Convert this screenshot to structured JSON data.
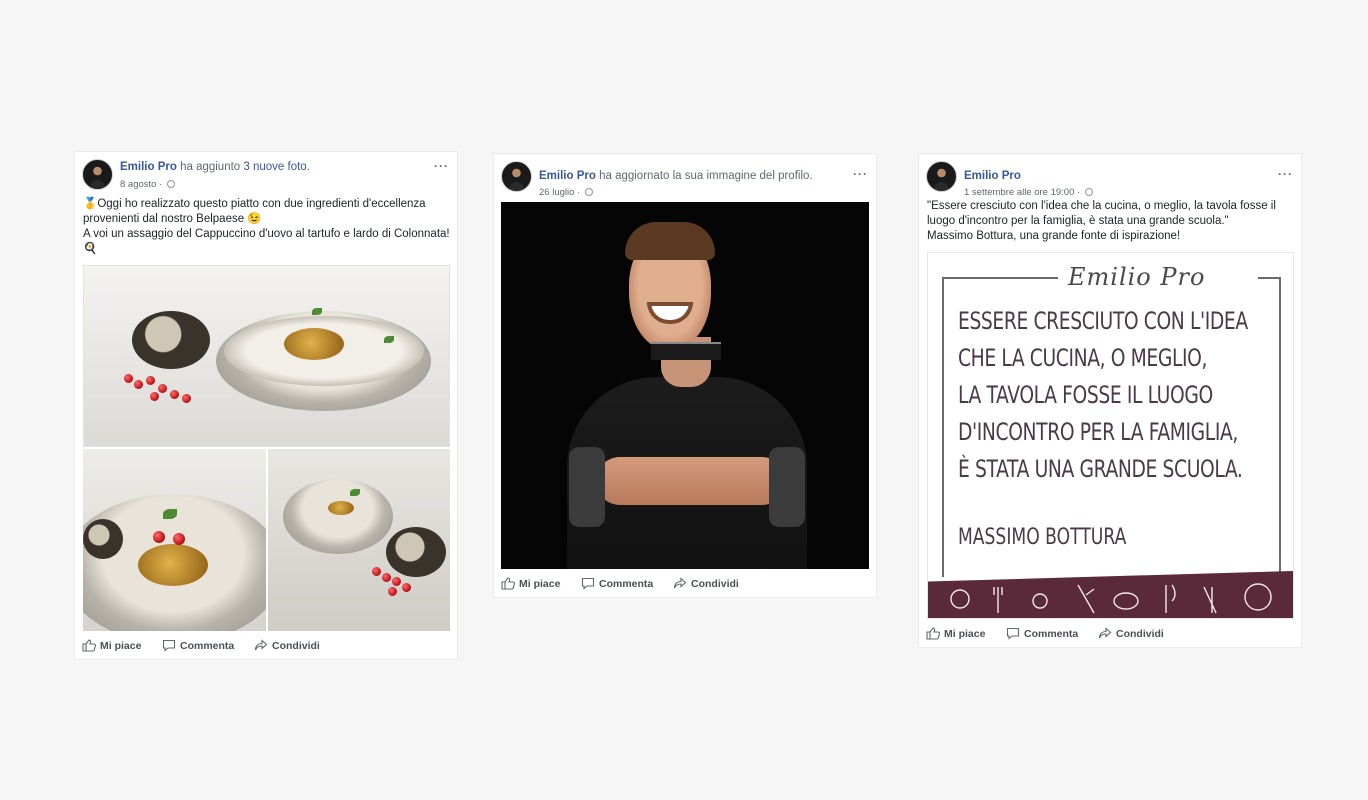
{
  "posts": [
    {
      "author": "Emilio Pro",
      "action": "ha aggiunto",
      "action_link": "3 nuove foto.",
      "date": "8 agosto",
      "meta_separator": "·",
      "more": "···",
      "text_lines": [
        "Oggi ho realizzato questo piatto con due ingredienti d'eccellenza",
        "provenienti dal nostro Belpaese 😉",
        "A voi un assaggio del Cappuccino d'uovo al tartufo e lardo di Colonnata!",
        "🍳"
      ],
      "leading_emoji": "🥇"
    },
    {
      "author": "Emilio Pro",
      "action": "ha aggiornato la sua immagine del profilo.",
      "date": "26 luglio",
      "meta_separator": "·",
      "more": "···"
    },
    {
      "author": "Emilio Pro",
      "date": "1 settembre alle ore 19:00",
      "meta_separator": "·",
      "more": "···",
      "text_lines": [
        "\"Essere cresciuto con l'idea che la cucina, o meglio, la tavola fosse il",
        "luogo d'incontro per la famiglia, è stata una grande scuola.\"",
        "Massimo Bottura, una grande fonte di ispirazione!"
      ],
      "quote_card": {
        "signature": "Emilio Pro",
        "lines": [
          "ESSERE CRESCIUTO CON L'IDEA",
          "CHE LA CUCINA, O MEGLIO,",
          "LA TAVOLA FOSSE IL LUOGO",
          "D'INCONTRO PER LA FAMIGLIA,",
          "È STATA UNA GRANDE SCUOLA."
        ],
        "attribution": "MASSIMO BOTTURA",
        "band_color": "#5a2a3a"
      }
    }
  ],
  "actions": {
    "like": "Mi piace",
    "comment": "Commenta",
    "share": "Condividi"
  },
  "colors": {
    "link": "#365899",
    "meta": "#616770",
    "background": "#f6f6f6"
  }
}
